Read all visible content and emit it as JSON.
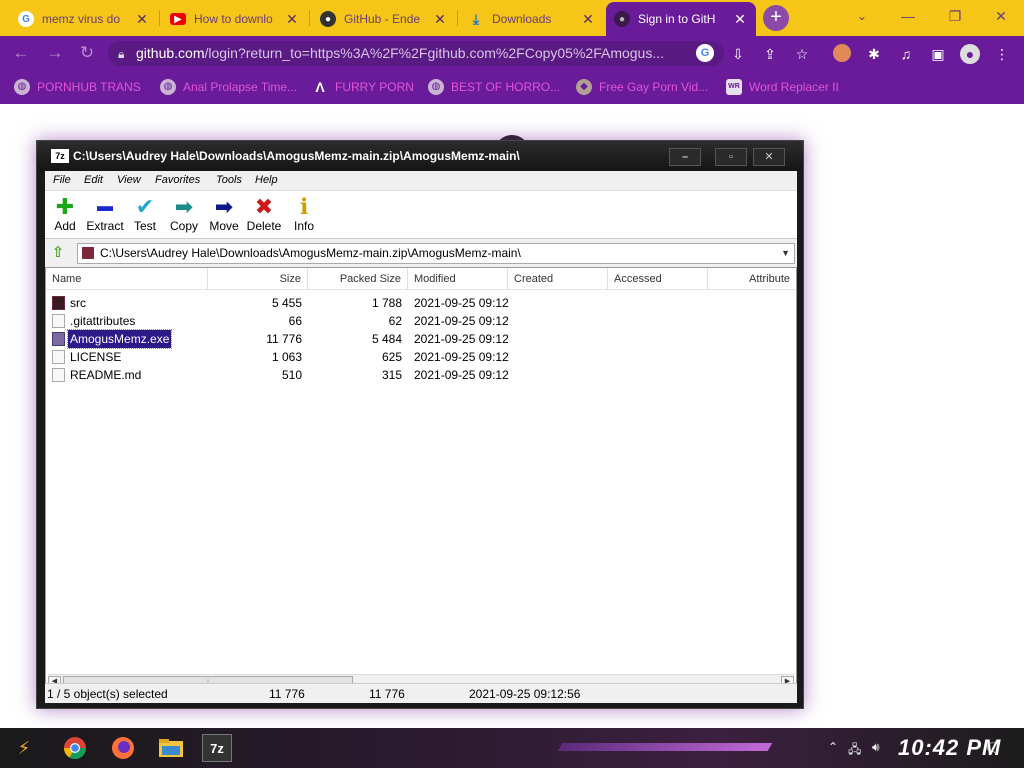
{
  "browser": {
    "tabs": [
      {
        "title": "memz virus do",
        "icon": "google-icon"
      },
      {
        "title": "How to downlo",
        "icon": "youtube-icon"
      },
      {
        "title": "GitHub - Ende",
        "icon": "github-icon"
      },
      {
        "title": "Downloads",
        "icon": "download-icon"
      },
      {
        "title": "Sign in to GitH",
        "icon": "github-icon",
        "active": true
      }
    ],
    "url_host": "github.com",
    "url_path": "/login?return_to=https%3A%2F%2Fgithub.com%2FCopy05%2FAmogus...",
    "bookmarks": [
      "PORNHUB TRANS",
      "Anal Prolapse Time...",
      "FURRY PORN",
      "BEST OF HORRO...",
      "Free Gay Porn Vid...",
      "Word Replacer II"
    ],
    "colors": {
      "tab_bar": "#f5c518",
      "chrome": "#6a1b9a",
      "bookmark_text": "#e055d8"
    }
  },
  "zip": {
    "title": "C:\\Users\\Audrey Hale\\Downloads\\AmogusMemz-main.zip\\AmogusMemz-main\\",
    "menu": [
      "File",
      "Edit",
      "View",
      "Favorites",
      "Tools",
      "Help"
    ],
    "toolbar": [
      {
        "label": "Add",
        "icon": "plus-icon",
        "glyph": "✚",
        "color": "#1aa81a"
      },
      {
        "label": "Extract",
        "icon": "minus-icon",
        "glyph": "▬",
        "color": "#1a2ad0"
      },
      {
        "label": "Test",
        "icon": "check-icon",
        "glyph": "✔",
        "color": "#20a8c8"
      },
      {
        "label": "Copy",
        "icon": "copy-arrow-icon",
        "glyph": "➡",
        "color": "#1a8a8a"
      },
      {
        "label": "Move",
        "icon": "move-arrow-icon",
        "glyph": "➡",
        "color": "#0a1a8a"
      },
      {
        "label": "Delete",
        "icon": "delete-x-icon",
        "glyph": "✖",
        "color": "#d01818"
      },
      {
        "label": "Info",
        "icon": "info-icon",
        "glyph": "ℹ",
        "color": "#c8a000"
      }
    ],
    "path": "C:\\Users\\Audrey Hale\\Downloads\\AmogusMemz-main.zip\\AmogusMemz-main\\",
    "columns": [
      "Name",
      "Size",
      "Packed Size",
      "Modified",
      "Created",
      "Accessed",
      "Attribute"
    ],
    "files": [
      {
        "name": "src",
        "type": "folder",
        "size": "5 455",
        "packed": "1 788",
        "modified": "2021-09-25 09:12"
      },
      {
        "name": ".gitattributes",
        "type": "file",
        "size": "66",
        "packed": "62",
        "modified": "2021-09-25 09:12"
      },
      {
        "name": "AmogusMemz.exe",
        "type": "exe",
        "size": "11 776",
        "packed": "5 484",
        "modified": "2021-09-25 09:12",
        "selected": true
      },
      {
        "name": "LICENSE",
        "type": "file",
        "size": "1 063",
        "packed": "625",
        "modified": "2021-09-25 09:12"
      },
      {
        "name": "README.md",
        "type": "file",
        "size": "510",
        "packed": "315",
        "modified": "2021-09-25 09:12"
      }
    ],
    "status": {
      "selection": "1 / 5 object(s) selected",
      "size": "11 776",
      "packed": "11 776",
      "modified": "2021-09-25 09:12:56"
    },
    "selection_color": "#2a1a8a"
  },
  "taskbar": {
    "apps": [
      {
        "name": "chrome",
        "icon": "chrome-icon"
      },
      {
        "name": "firefox",
        "icon": "firefox-icon"
      },
      {
        "name": "file-explorer",
        "icon": "folder-icon"
      },
      {
        "name": "7zip",
        "icon": "sevenzip-icon",
        "label": "7z"
      }
    ],
    "clock": "10:42 PM"
  }
}
